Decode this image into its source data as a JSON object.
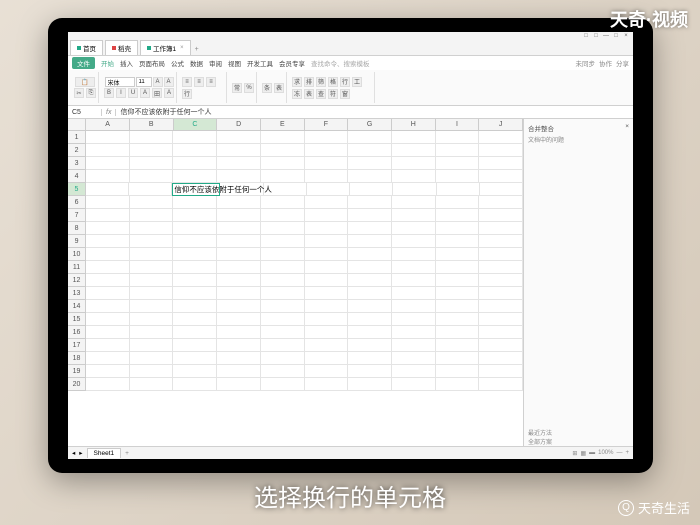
{
  "watermarks": {
    "top": "天奇·视频",
    "bottom": "天奇生活"
  },
  "caption": "选择换行的单元格",
  "titlebar": {
    "min": "—",
    "max": "□",
    "close": "×",
    "extra1": "□",
    "extra2": "□"
  },
  "file_tabs": [
    {
      "label": "首页"
    },
    {
      "label": "稻壳"
    },
    {
      "label": "工作簿1"
    }
  ],
  "menu": {
    "file": "文件",
    "items": [
      "开始",
      "插入",
      "页面布局",
      "公式",
      "数据",
      "审阅",
      "视图",
      "开发工具",
      "会员专享"
    ],
    "search_placeholder": "查找命令、搜索模板",
    "right": [
      "未同步",
      "协作",
      "分享"
    ]
  },
  "ribbon": {
    "paste": "粘贴",
    "copy": "复制",
    "cut": "格式刷",
    "font_name": "宋体",
    "font_size": "11",
    "buttons": [
      "B",
      "I",
      "U",
      "A",
      "田",
      "A",
      "≡",
      "≡",
      "≡",
      "行",
      "常",
      "%",
      "条",
      "表",
      "求",
      "排",
      "筛",
      "格",
      "行",
      "工",
      "冻",
      "表",
      "查",
      "符",
      "窗"
    ]
  },
  "formula": {
    "cell_ref": "C5",
    "fx": "fx",
    "content": "信仰不应该依附于任何一个人"
  },
  "columns": [
    "A",
    "B",
    "C",
    "D",
    "E",
    "F",
    "G",
    "H",
    "I",
    "J"
  ],
  "row_count": 20,
  "selected": {
    "row": 5,
    "col": "C",
    "value": "信仰不应该依附于任何一个人"
  },
  "side_panel": {
    "title": "合并整合",
    "close": "×",
    "subtitle": "文档中的问题",
    "footer1": "最近方法",
    "footer2": "全部方案"
  },
  "sheet": {
    "name": "Sheet1",
    "plus": "+",
    "status": [
      "⊞",
      "▦",
      "▬",
      "100%",
      "—",
      "+"
    ]
  }
}
